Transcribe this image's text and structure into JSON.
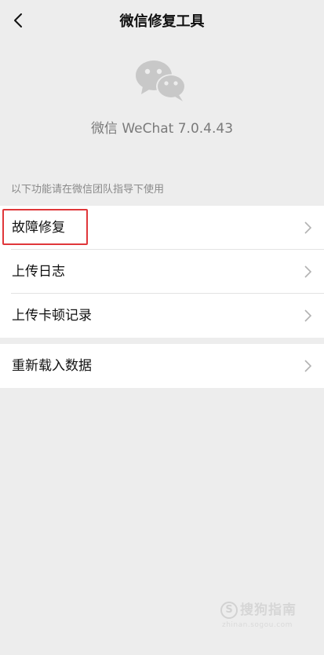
{
  "header": {
    "title": "微信修复工具",
    "back_icon": "chevron-left-icon"
  },
  "app_info": {
    "logo_icon": "wechat-logo-icon",
    "version_text": "微信 WeChat 7.0.4.43"
  },
  "section_hint": "以下功能请在微信团队指导下使用",
  "menu_group_1": [
    {
      "label": "故障修复",
      "highlighted": true
    },
    {
      "label": "上传日志",
      "highlighted": false
    },
    {
      "label": "上传卡顿记录",
      "highlighted": false
    }
  ],
  "menu_group_2": [
    {
      "label": "重新载入数据"
    }
  ],
  "colors": {
    "background": "#ededed",
    "cell_background": "#ffffff",
    "highlight_border": "#e0373a",
    "secondary_text": "#7a7a7a"
  },
  "watermark": {
    "mark": "S",
    "text": "搜狗指南",
    "url": "zhinan.sogou.com"
  }
}
